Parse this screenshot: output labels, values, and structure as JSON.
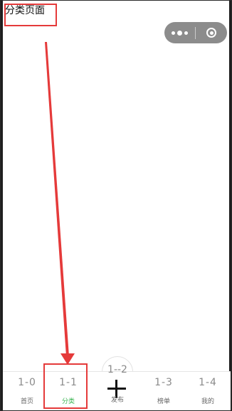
{
  "page": {
    "title": "分类页面"
  },
  "capsule": {
    "more_icon": "more-dots-icon",
    "close_icon": "target-circle-icon",
    "color": "#8c8c8c"
  },
  "annotation": {
    "arrow_color": "#e53a3a",
    "highlight_color": "#e53a3a"
  },
  "tabbar": {
    "tabs": [
      {
        "icon_text": "1-0",
        "label": "首页"
      },
      {
        "icon_text": "1-1",
        "label": "分类",
        "active": true
      },
      {
        "icon_text": "1--2",
        "label": "发布"
      },
      {
        "icon_text": "1-3",
        "label": "榜单"
      },
      {
        "icon_text": "1-4",
        "label": "我的"
      }
    ],
    "active_color": "#3cb554"
  }
}
